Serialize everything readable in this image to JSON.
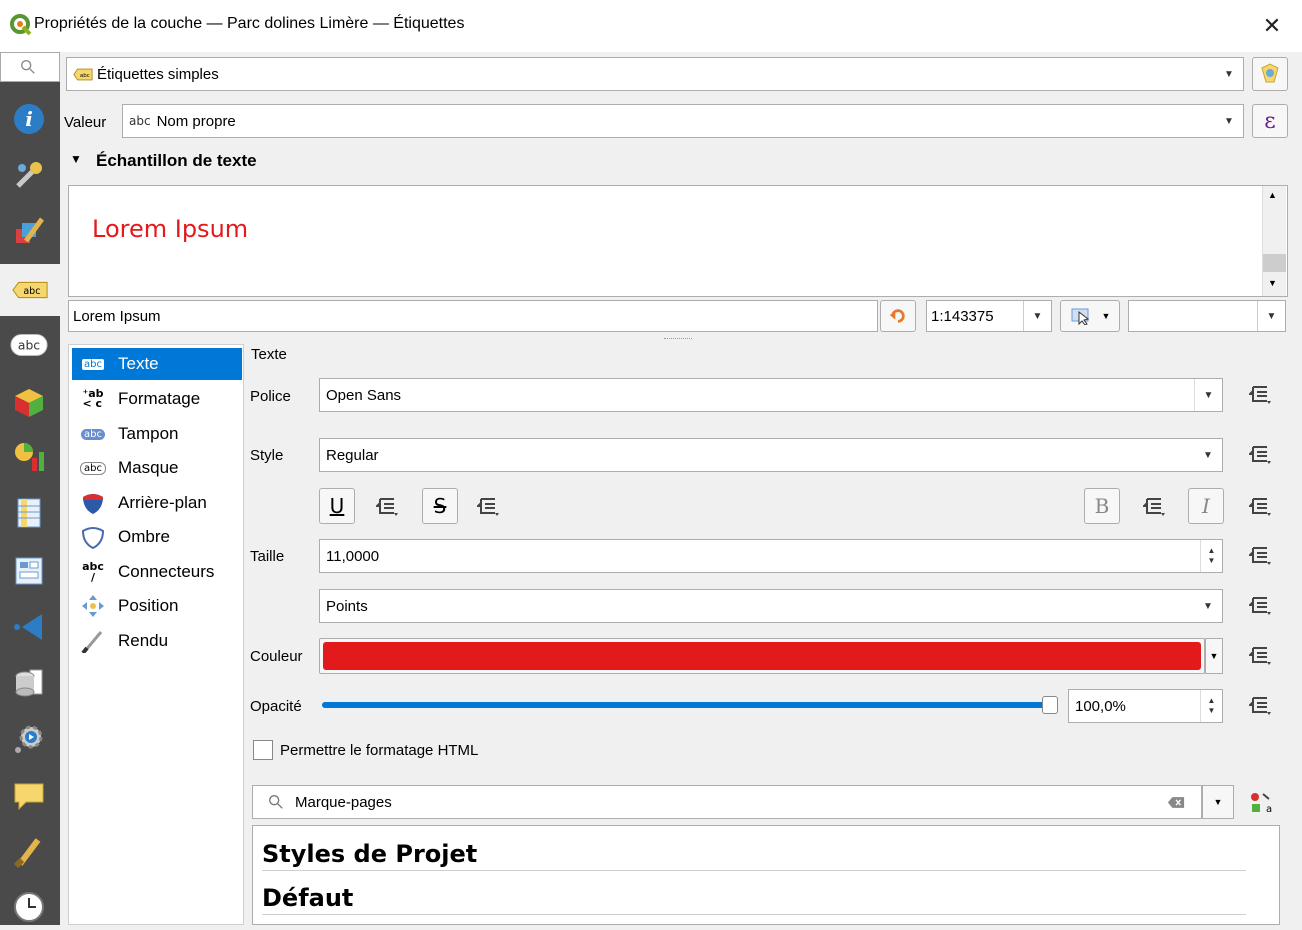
{
  "window": {
    "title": "Propriétés de la couche — Parc dolines Limère — Étiquettes",
    "close": "✕"
  },
  "mode": {
    "value": "Étiquettes simples"
  },
  "value_row": {
    "label": "Valeur",
    "value": "Nom propre",
    "epsilon": "ε"
  },
  "sample": {
    "header": "Échantillon de texte",
    "preview_text": "Lorem Ipsum",
    "input_value": "Lorem Ipsum",
    "scale": "1:143375"
  },
  "tabs": [
    {
      "label": "Texte",
      "icon": "abc-text-icon",
      "active": true
    },
    {
      "label": "Formatage",
      "icon": "formatting-icon"
    },
    {
      "label": "Tampon",
      "icon": "buffer-icon"
    },
    {
      "label": "Masque",
      "icon": "mask-icon"
    },
    {
      "label": "Arrière-plan",
      "icon": "background-shield-icon"
    },
    {
      "label": "Ombre",
      "icon": "shadow-icon"
    },
    {
      "label": "Connecteurs",
      "icon": "callout-icon"
    },
    {
      "label": "Position",
      "icon": "position-arrows-icon"
    },
    {
      "label": "Rendu",
      "icon": "rendering-brush-icon"
    }
  ],
  "text": {
    "section_title": "Texte",
    "police_label": "Police",
    "police_value": "Open Sans",
    "style_label": "Style",
    "style_value": "Regular",
    "underline": "U",
    "strike": "S",
    "bold": "B",
    "italic": "I",
    "taille_label": "Taille",
    "taille_value": "11,0000",
    "unit_value": "Points",
    "couleur_label": "Couleur",
    "couleur_color": "#e31a1c",
    "opacite_label": "Opacité",
    "opacite_value": "100,0%",
    "opacity_fraction": 1.0,
    "html_label": "Permettre le formatage HTML",
    "html_checked": false
  },
  "styles": {
    "search_value": "Marque-pages",
    "headings": [
      "Styles de Projet",
      "Défaut"
    ]
  },
  "colors": {
    "accent": "#0078d7",
    "sidebar": "#4a4a4a"
  }
}
